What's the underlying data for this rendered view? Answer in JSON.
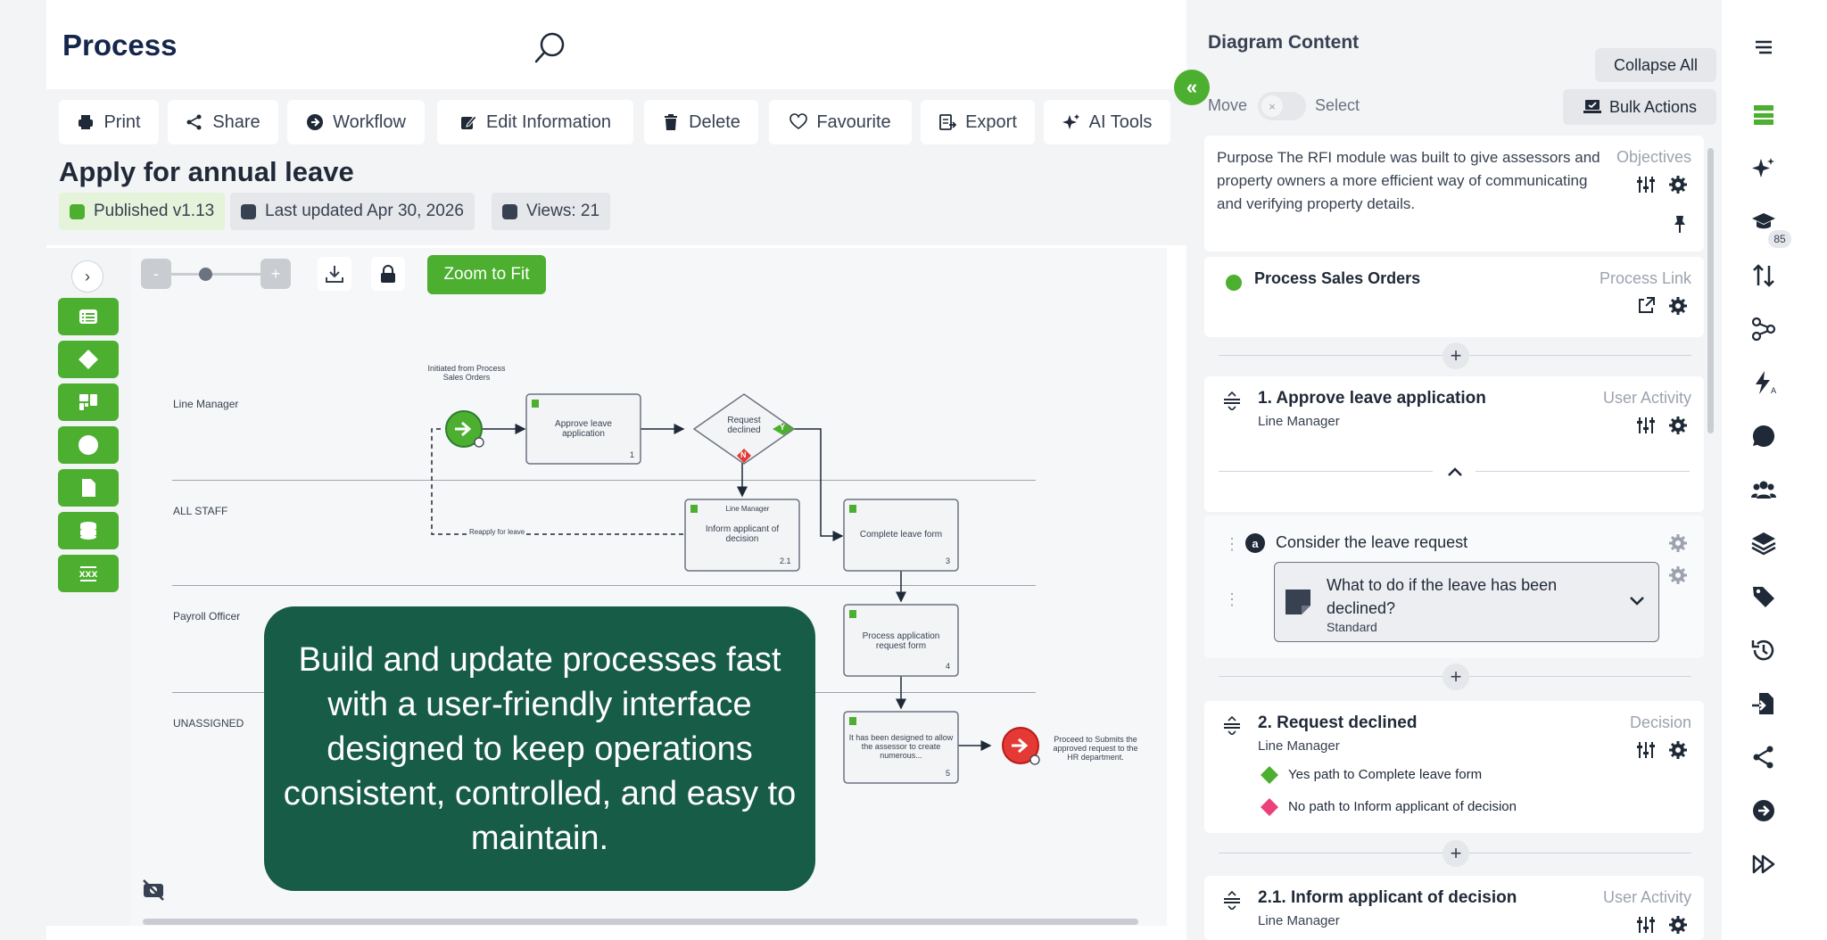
{
  "app": {
    "title": "Process"
  },
  "toolbar": {
    "buttons": [
      {
        "label": "Print",
        "icon": "print-icon"
      },
      {
        "label": "Share",
        "icon": "share-icon"
      },
      {
        "label": "Workflow",
        "icon": "workflow-icon"
      },
      {
        "label": "Edit Information",
        "icon": "edit-icon"
      },
      {
        "label": "Delete",
        "icon": "trash-icon"
      },
      {
        "label": "Favourite",
        "icon": "heart-icon"
      },
      {
        "label": "Export",
        "icon": "export-icon"
      },
      {
        "label": "AI Tools",
        "icon": "sparkle-icon"
      }
    ]
  },
  "page": {
    "title": "Apply for annual leave",
    "badges": {
      "published": "Published v1.13",
      "updated": "Last updated Apr 30, 2026",
      "views": "Views: 21"
    }
  },
  "canvas": {
    "zoom_fit": "Zoom to Fit",
    "zoom_minus": "-",
    "zoom_plus": "+",
    "lanes": [
      "Line Manager",
      "ALL STAFF",
      "Payroll Officer",
      "UNASSIGNED"
    ],
    "start_note": "Initiated from Process Sales Orders",
    "end_note": "Proceed to Submits the approved request to the HR department.",
    "loop_label": "Reapply for leave",
    "nodes": {
      "approve": {
        "label": "Approve leave application",
        "num": "1"
      },
      "decision": {
        "label": "Request declined",
        "yes": "Y",
        "no": "N"
      },
      "inform": {
        "role": "Line Manager",
        "label": "Inform applicant of decision",
        "num": "2.1"
      },
      "complete": {
        "label": "Complete leave form",
        "num": "3"
      },
      "process": {
        "label": "Process application request form",
        "num": "4"
      },
      "assessor": {
        "label": "It has been designed to allow the assessor to create numerous...",
        "num": "5"
      }
    }
  },
  "callout": "Build and update processes fast with a user-friendly interface designed to keep operations consistent, controlled, and easy to maintain.",
  "panel": {
    "title": "Diagram Content",
    "collapse_all": "Collapse All",
    "mode_move": "Move",
    "mode_select": "Select",
    "bulk_actions": "Bulk Actions",
    "objective": {
      "text": "Purpose The RFI module was built to give assessors and property owners a more efficient way of communicating and verifying property details.",
      "type": "Objectives"
    },
    "process_link": {
      "title": "Process Sales Orders",
      "type": "Process Link"
    },
    "step1": {
      "title": "1.  Approve leave application",
      "role": "Line Manager",
      "type": "User Activity",
      "task": "Consider the leave request",
      "task_marker": "a",
      "question": "What to do if the leave has been declined?",
      "question_sub": "Standard"
    },
    "step2": {
      "title": "2.  Request declined",
      "role": "Line Manager",
      "type": "Decision",
      "yes_path": "Yes path to Complete leave form",
      "no_path": "No path to Inform applicant of decision"
    },
    "step21": {
      "title": "2.1.  Inform applicant of decision",
      "role": "Line Manager",
      "type": "User Activity"
    }
  },
  "rail": {
    "badge": "85"
  },
  "colors": {
    "accent": "#4caf2f",
    "navy": "#14264a",
    "callout": "#175c47",
    "decline": "#e53935",
    "no_path": "#ec407a"
  }
}
